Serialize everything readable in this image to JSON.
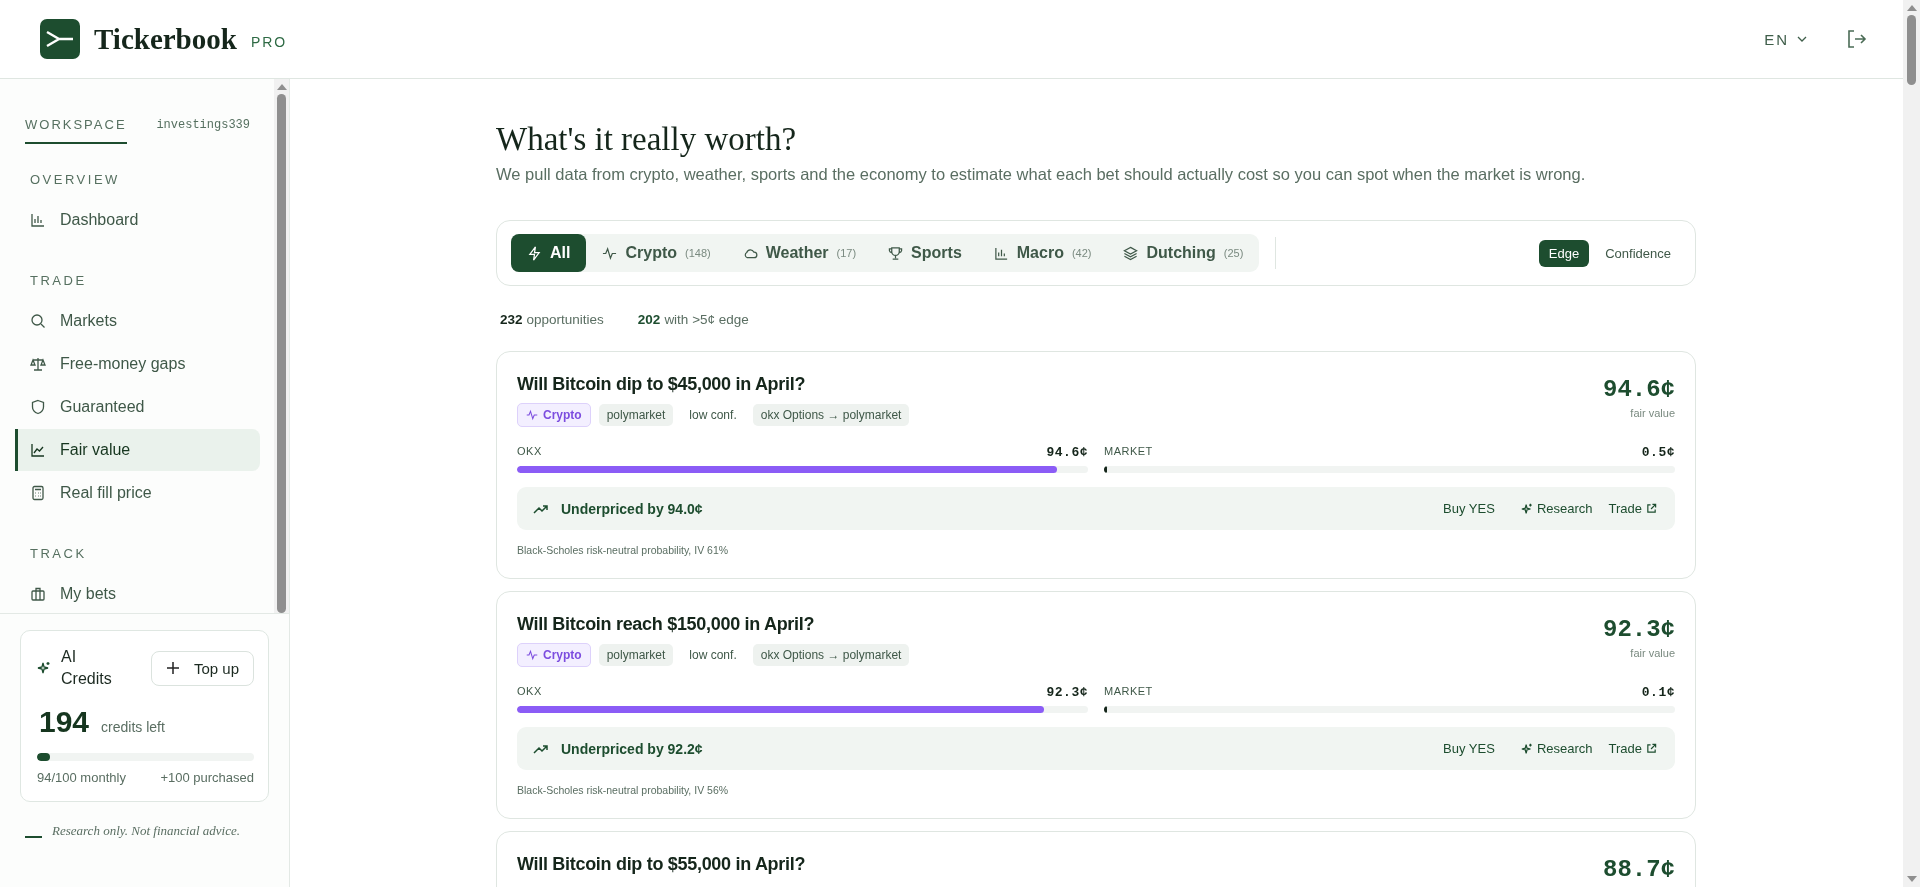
{
  "header": {
    "brand": "Tickerbook",
    "tier": "PRO",
    "language": "EN"
  },
  "sidebar": {
    "workspace_label": "WORKSPACE",
    "workspace_name": "investings339",
    "sections": [
      {
        "title": "OVERVIEW",
        "items": [
          {
            "label": "Dashboard",
            "selected": false
          }
        ]
      },
      {
        "title": "TRADE",
        "items": [
          {
            "label": "Markets",
            "selected": false
          },
          {
            "label": "Free-money gaps",
            "selected": false
          },
          {
            "label": "Guaranteed",
            "selected": false
          },
          {
            "label": "Fair value",
            "selected": true
          },
          {
            "label": "Real fill price",
            "selected": false
          }
        ]
      },
      {
        "title": "TRACK",
        "items": [
          {
            "label": "My bets",
            "selected": false
          }
        ]
      }
    ],
    "credits": {
      "title": "AI Credits",
      "button": "Top up",
      "amount": "194",
      "unit": "credits left",
      "level": 0.06,
      "monthly": "94/100 monthly",
      "purchased": "+100 purchased"
    },
    "disclaimer": "Research only. Not financial advice."
  },
  "page": {
    "title": "What's it really worth?",
    "subtitle": "We pull data from crypto, weather, sports and the economy to estimate what each bet should actually cost so you can spot when the market is wrong.",
    "filters": [
      {
        "label": "All",
        "selected": true
      },
      {
        "label": "Crypto",
        "count": "(148)",
        "selected": false
      },
      {
        "label": "Weather",
        "count": "(17)",
        "selected": false
      },
      {
        "label": "Sports",
        "selected": false
      },
      {
        "label": "Macro",
        "count": "(42)",
        "selected": false
      },
      {
        "label": "Dutching",
        "count": "(25)",
        "selected": false
      }
    ],
    "sort": [
      {
        "label": "Edge",
        "selected": true
      },
      {
        "label": "Confidence",
        "selected": false
      }
    ],
    "stats": [
      {
        "value": "232",
        "label": "opportunities",
        "kind": "total"
      },
      {
        "value": "202",
        "label": "with >5¢ edge",
        "kind": "edge"
      }
    ],
    "cards": [
      {
        "title": "Will Bitcoin dip to $45,000 in April?",
        "fair_value": "94.6¢",
        "fair_label": "fair value",
        "tags": [
          {
            "label": "Crypto",
            "kind": "category"
          },
          {
            "label": "polymarket",
            "kind": "chip"
          },
          {
            "label": "low conf.",
            "kind": "plain"
          },
          {
            "label": "okx Options → polymarket",
            "kind": "chip"
          }
        ],
        "bars": [
          {
            "label": "OKX",
            "reading": "94.6¢",
            "level": 0.946,
            "kind": "model"
          },
          {
            "label": "MARKET",
            "reading": "0.5¢",
            "level": 0.005,
            "kind": "market"
          }
        ],
        "verdict": "Underpriced by 94.0¢",
        "actions": [
          "Buy YES",
          "Research",
          "Trade"
        ],
        "note": "Black-Scholes risk-neutral probability, IV 61%"
      },
      {
        "title": "Will Bitcoin reach $150,000 in April?",
        "fair_value": "92.3¢",
        "fair_label": "fair value",
        "tags": [
          {
            "label": "Crypto",
            "kind": "category"
          },
          {
            "label": "polymarket",
            "kind": "chip"
          },
          {
            "label": "low conf.",
            "kind": "plain"
          },
          {
            "label": "okx Options → polymarket",
            "kind": "chip"
          }
        ],
        "bars": [
          {
            "label": "OKX",
            "reading": "92.3¢",
            "level": 0.923,
            "kind": "model"
          },
          {
            "label": "MARKET",
            "reading": "0.1¢",
            "level": 0.001,
            "kind": "market"
          }
        ],
        "verdict": "Underpriced by 92.2¢",
        "actions": [
          "Buy YES",
          "Research",
          "Trade"
        ],
        "note": "Black-Scholes risk-neutral probability, IV 56%"
      },
      {
        "title": "Will Bitcoin dip to $55,000 in April?",
        "fair_value": "88.7¢"
      }
    ]
  }
}
